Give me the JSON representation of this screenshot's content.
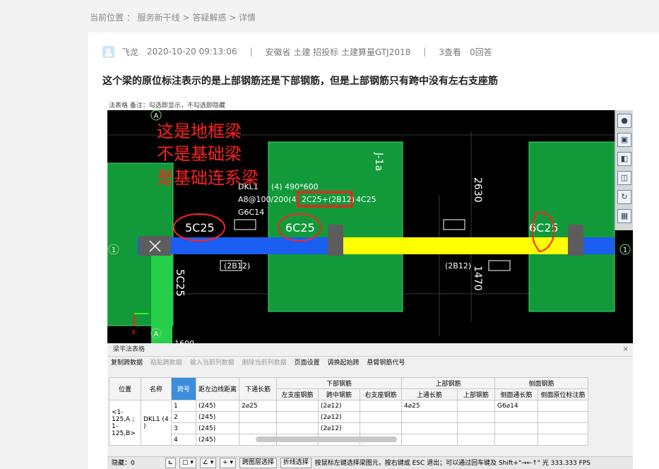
{
  "breadcrumb": {
    "text": "当前位置 ： 服务新干线 > 答疑解惑 > 详情"
  },
  "post": {
    "author": "飞龙",
    "date": "2020-10-20 09:13:06",
    "sep": "|",
    "tags": "安徽省  土建 招投标 土建算量GTJ2018",
    "views": "3查看",
    "answers": "0回答",
    "title": "这个梁的原位标注表示的是上部钢筋还是下部钢筋，但是上部钢筋只有跨中没有左右支座筋"
  },
  "screenshot": {
    "top_text": "法表格    备注：勾选即显示，不勾选即隐藏",
    "annotations": [
      "这是地框梁",
      "不是基础梁",
      "是基础连系梁"
    ],
    "cad_labels": {
      "beam_name": "DKL1",
      "beam_spec": "(4) 490*600",
      "stirrup": "A8@100/200(4)",
      "top_bar_highlight": "2C25+(2B12)",
      "bottom_bar": "4C25",
      "side_bar": "G6C14",
      "seat_left": "5C25",
      "seat_mid": "6C25",
      "seat_right": "6C25",
      "vertical_left": "5C25",
      "dim_top": "2630",
      "dim_bottom": "1470",
      "foot_label": "J-1a",
      "under_left": "(2B12)",
      "under_right": "(2B12)",
      "axis_a": "A",
      "axis_1": "1",
      "bottom_cut": "1600"
    },
    "tool3d_icons": [
      "sphere",
      "3D",
      "cube-front",
      "cube",
      "rotate",
      "grid"
    ],
    "panel": {
      "title": "梁平法表格",
      "close": "×",
      "toolbar": [
        {
          "label": "复制跨数据",
          "disabled": false
        },
        {
          "label": "粘贴跨数据",
          "disabled": true
        },
        {
          "label": "输入当前列数据",
          "disabled": true
        },
        {
          "label": "删除当前列数据",
          "disabled": true
        },
        {
          "label": "页面设置",
          "disabled": false
        },
        {
          "label": "调换起始跨",
          "disabled": false
        },
        {
          "label": "悬臂钢筋代号",
          "disabled": false
        }
      ],
      "headers": {
        "position": "位置",
        "name": "名称",
        "span": "跨号",
        "left_dist": "距左边线距离",
        "bottom_long": "下通长筋",
        "group_bottom": "下部钢筋",
        "group_top": "上部钢筋",
        "group_side": "侧面钢筋",
        "b_left": "左支座钢筋",
        "b_mid": "跨中钢筋",
        "b_right": "右支座钢筋",
        "t_long": "上通长筋",
        "t_bar": "上部钢筋",
        "s_long": "侧面通长筋",
        "s_orig": "侧面原位标注筋"
      },
      "rows": [
        {
          "idx": "1",
          "span": "1",
          "dist": "(245)",
          "bottom_long": "2⌀25",
          "mid": "(2⌀12)",
          "top_long": "4⌀25",
          "side_long": "G6⌀14"
        },
        {
          "idx": "2",
          "span": "2",
          "dist": "(245)",
          "bottom_long": "",
          "mid": "(2⌀12)",
          "top_long": "",
          "side_long": ""
        },
        {
          "idx": "3",
          "span": "3",
          "dist": "(245)",
          "bottom_long": "",
          "mid": "(2⌀12)",
          "top_long": "",
          "side_long": ""
        },
        {
          "idx": "4",
          "span": "4",
          "dist": "(245)",
          "bottom_long": "",
          "mid": "(2⌀12)",
          "top_long": "",
          "side_long": ""
        }
      ],
      "position_text": "<1-125,A ; 1-125,B>",
      "name_text": "DKL1 (4 )",
      "status": {
        "hidden": "隐藏：0",
        "btn1": "跨图层选择",
        "btn2": "折线选择",
        "hint": "按鼠标左键选择梁图元，按右键或 ESC 退出；可以通过回车键及 Shift+\"→←↑\" 光 333.333 FPS"
      }
    }
  }
}
